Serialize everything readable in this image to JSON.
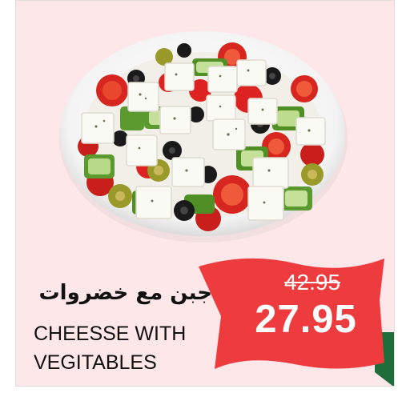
{
  "product": {
    "name_ar": "جبن مع خضروات",
    "name_en_line1": "CHEESSE WITH",
    "name_en_line2": "VEGITABLES"
  },
  "price": {
    "old": "42.95",
    "new": "27.95"
  },
  "image": {
    "semantic": "greek-salad-bowl-image"
  },
  "colors": {
    "card_bg": "#fde7e8",
    "banner_red": "#ee3b3e",
    "banner_green": "#1e6d3b"
  }
}
